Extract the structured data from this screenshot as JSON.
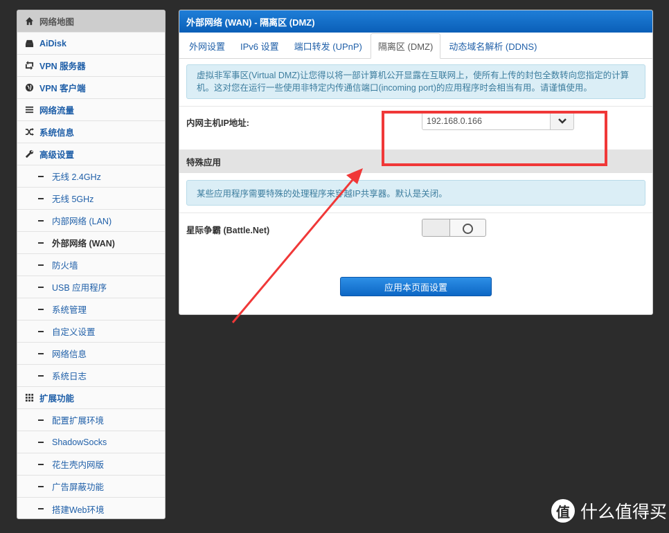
{
  "sidebar": {
    "items": [
      {
        "label": "网络地图",
        "icon": "home-icon",
        "level": 0,
        "active": true
      },
      {
        "label": "AiDisk",
        "icon": "disk-icon",
        "level": 0
      },
      {
        "label": "VPN 服务器",
        "icon": "loop-icon",
        "level": 0
      },
      {
        "label": "VPN 客户端",
        "icon": "globe-icon",
        "level": 0
      },
      {
        "label": "网络流量",
        "icon": "list-icon",
        "level": 0
      },
      {
        "label": "系统信息",
        "icon": "shuffle-icon",
        "level": 0
      },
      {
        "label": "高级设置",
        "icon": "wrench-icon",
        "level": 0
      },
      {
        "label": "无线 2.4GHz",
        "level": 1
      },
      {
        "label": "无线 5GHz",
        "level": 1
      },
      {
        "label": "内部网络 (LAN)",
        "level": 1
      },
      {
        "label": "外部网络 (WAN)",
        "level": 1,
        "current": true
      },
      {
        "label": "防火墙",
        "level": 1
      },
      {
        "label": "USB 应用程序",
        "level": 1
      },
      {
        "label": "系统管理",
        "level": 1
      },
      {
        "label": "自定义设置",
        "level": 1
      },
      {
        "label": "网络信息",
        "level": 1
      },
      {
        "label": "系统日志",
        "level": 1
      },
      {
        "label": "扩展功能",
        "icon": "grid-icon",
        "level": 0
      },
      {
        "label": "配置扩展环境",
        "level": 1
      },
      {
        "label": "ShadowSocks",
        "level": 1
      },
      {
        "label": "花生壳内网版",
        "level": 1
      },
      {
        "label": "广告屏蔽功能",
        "level": 1
      },
      {
        "label": "搭建Web环境",
        "level": 1
      }
    ]
  },
  "panel": {
    "title": "外部网络 (WAN) - 隔离区 (DMZ)",
    "tabs": [
      {
        "label": "外网设置"
      },
      {
        "label": "IPv6 设置"
      },
      {
        "label": "端口转发 (UPnP)"
      },
      {
        "label": "隔离区 (DMZ)",
        "active": true
      },
      {
        "label": "动态域名解析 (DDNS)"
      }
    ],
    "dmz_info": "虚拟非军事区(Virtual DMZ)让您得以将一部计算机公开显露在互联网上，使所有上传的封包全数转向您指定的计算机。这对您在运行一些使用非特定内传通信端口(incoming port)的应用程序时会相当有用。请谨慎使用。",
    "host_ip_label": "内网主机IP地址:",
    "host_ip_value": "192.168.0.166",
    "special_heading": "特殊应用",
    "special_info": "某些应用程序需要特殊的处理程序来穿越IP共享器。默认是关闭。",
    "battlenet_label": "星际争霸 (Battle.Net)",
    "battlenet_enabled": false,
    "apply_label": "应用本页面设置"
  },
  "watermark": {
    "logo": "值",
    "text": "什么值得买"
  },
  "colors": {
    "accent": "#0d67c5",
    "annotation": "#f03838",
    "link": "#1f5fa8",
    "info_bg": "#dbeef6"
  }
}
